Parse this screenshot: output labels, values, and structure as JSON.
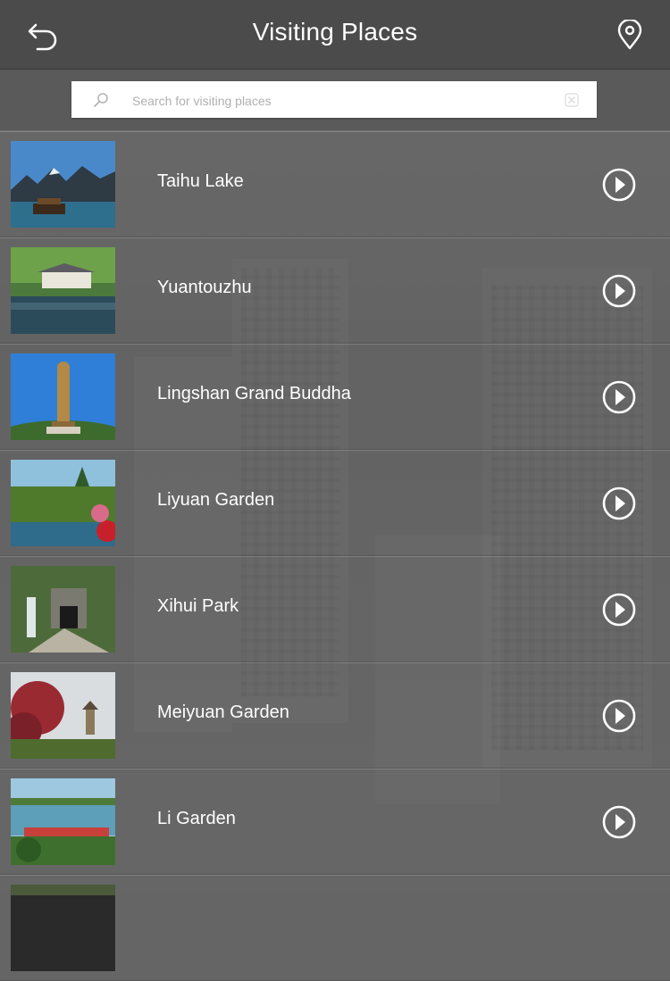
{
  "header": {
    "title": "Visiting Places",
    "back_icon": "back-icon",
    "location_icon": "location-pin-icon"
  },
  "search": {
    "placeholder": "Search for visiting places",
    "value": ""
  },
  "places": [
    {
      "name": "Taihu Lake"
    },
    {
      "name": "Yuantouzhu"
    },
    {
      "name": "Lingshan Grand Buddha"
    },
    {
      "name": "Liyuan Garden"
    },
    {
      "name": "Xihui Park"
    },
    {
      "name": "Meiyuan Garden"
    },
    {
      "name": "Li Garden"
    }
  ],
  "colors": {
    "navbar": "#4b4b4b",
    "text": "#ffffff"
  }
}
